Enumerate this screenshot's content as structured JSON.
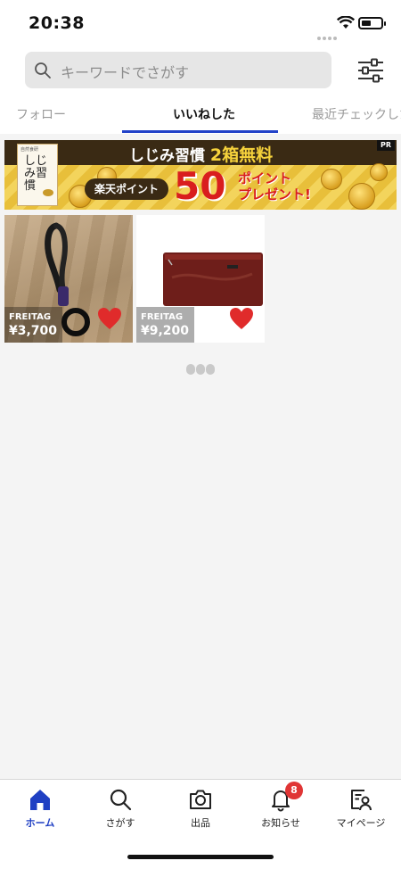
{
  "status_bar": {
    "time": "20:38"
  },
  "search": {
    "placeholder": "キーワードでさがす"
  },
  "tabs": [
    {
      "label": "フォロー",
      "selected": false
    },
    {
      "label": "いいねした",
      "selected": true
    },
    {
      "label": "最近チェックした",
      "selected": false
    }
  ],
  "banner": {
    "product_name": "しじみ習慣",
    "headline_main": "しじみ習慣",
    "headline_highlight": "2箱無料",
    "pill": "楽天ポイント",
    "amount": "50",
    "points_line1": "ポイント",
    "points_line2": "プレゼント!",
    "badge": "PR"
  },
  "items": [
    {
      "brand": "FREITAG",
      "price": "¥3,700",
      "liked": true
    },
    {
      "brand": "FREITAG",
      "price": "¥9,200",
      "liked": true
    }
  ],
  "tabbar": {
    "items": [
      {
        "label": "ホーム",
        "icon": "home-icon",
        "active": true
      },
      {
        "label": "さがす",
        "icon": "search-icon",
        "active": false
      },
      {
        "label": "出品",
        "icon": "camera-icon",
        "active": false
      },
      {
        "label": "お知らせ",
        "icon": "bell-icon",
        "active": false,
        "badge": "8"
      },
      {
        "label": "マイページ",
        "icon": "profile-icon",
        "active": false
      }
    ]
  },
  "colors": {
    "accent": "#2242c8",
    "like": "#e02b2b",
    "badge": "#e03535"
  }
}
